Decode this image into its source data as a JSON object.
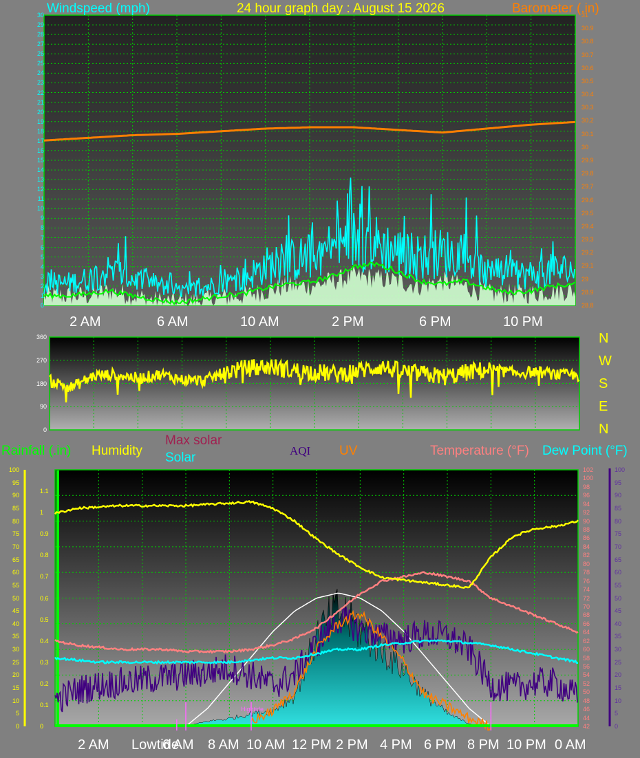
{
  "colors": {
    "background": "#808080",
    "grid": "#00d000",
    "windspeed": "#00ffff",
    "gust_under": "#d0ffd0",
    "wind_avg": "#00ff00",
    "barometer": "#ff7f00",
    "direction": "#ffff00",
    "humidity": "#ffff00",
    "temperature": "#ff8080",
    "dewpoint": "#00ffff",
    "solar": "#00cccc",
    "max_solar": "#ffffff",
    "aqi": "#400080",
    "uv": "#ff8000",
    "rainfall": "#00ff00",
    "markers": "#ff66ff"
  },
  "header": {
    "title": "24 hour graph day : August 15 2026",
    "windspeed_label": "Windspeed (mph)",
    "barometer_label": "Barometer (.in)"
  },
  "direction_panel": {
    "compass": [
      "N",
      "W",
      "S",
      "E",
      "N"
    ],
    "ticks": [
      "360",
      "270",
      "180",
      "90",
      "0"
    ]
  },
  "bottom_legend": {
    "rainfall": "Rainfall (.in)",
    "humidity": "Humidity",
    "max_solar": "Max solar",
    "solar": "Solar",
    "aqi": "AQI",
    "uv": "UV",
    "temperature": "Temperature (°F)",
    "dewpoint": "Dew Point (°F)",
    "lowtide": "Lowtide",
    "hightide": "Hightide"
  },
  "top_xlabels": [
    "2 AM",
    "6 AM",
    "10 AM",
    "2 PM",
    "6 PM",
    "10 PM"
  ],
  "bottom_xlabels": [
    "2 AM",
    "6 AM",
    "8 AM",
    "10 AM",
    "12 PM",
    "2 PM",
    "4 PM",
    "6 PM",
    "8 PM",
    "10 PM",
    "0 AM"
  ],
  "chart_data": [
    {
      "type": "line",
      "title": "24 hour graph day : August 15 2026",
      "x_unit": "hour",
      "xlim": [
        0,
        24
      ],
      "y_left": {
        "label": "Windspeed (mph)",
        "ylim": [
          0,
          30
        ],
        "ticks": [
          "0",
          "1",
          "2",
          "3",
          "4",
          "5",
          "6",
          "7",
          "8",
          "9",
          "10",
          "11",
          "12",
          "13",
          "14",
          "15",
          "16",
          "17",
          "18",
          "19",
          "20",
          "21",
          "22",
          "23",
          "24",
          "25",
          "26",
          "27",
          "28",
          "29",
          "30"
        ]
      },
      "y_right": {
        "label": "Barometer (.in)",
        "ylim": [
          28.8,
          31
        ],
        "ticks": [
          "28.8",
          "28.9",
          "29",
          "29.1",
          "29.2",
          "29.3",
          "29.4",
          "29.5",
          "29.6",
          "29.7",
          "29.8",
          "29.9",
          "30",
          "30.1",
          "30.2",
          "30.3",
          "30.4",
          "30.5",
          "30.6",
          "30.7",
          "30.8",
          "30.9",
          "31"
        ]
      },
      "series": [
        {
          "name": "Windspeed (mph)",
          "style": "spiky",
          "x": [
            0,
            1,
            2,
            3,
            4,
            5,
            6,
            7,
            8,
            9,
            10,
            11,
            12,
            13,
            14,
            15,
            16,
            17,
            18,
            19,
            20,
            21,
            22,
            23,
            24
          ],
          "values": [
            2.5,
            2.5,
            3,
            4,
            3,
            2.5,
            1.5,
            2,
            2.5,
            3,
            4.5,
            5,
            5.5,
            6.5,
            7.5,
            7,
            6,
            5.5,
            6,
            5.5,
            3.5,
            3.5,
            3.5,
            4,
            4
          ]
        },
        {
          "style": "filled",
          "x": [
            0,
            1,
            2,
            3,
            4,
            5,
            6,
            7,
            8,
            9,
            10,
            11,
            12,
            13,
            14,
            15,
            16,
            17,
            18,
            19,
            20,
            21,
            22,
            23,
            24
          ],
          "values": [
            1,
            1,
            1,
            1.5,
            1,
            0.5,
            0.3,
            0.5,
            0.8,
            1,
            1.5,
            2,
            2,
            2.5,
            3,
            2.8,
            2.5,
            2,
            2.5,
            2,
            1.2,
            1.2,
            1.2,
            1.5,
            1.5
          ]
        },
        {
          "style": "line",
          "x": [
            0,
            1,
            2,
            3,
            4,
            5,
            6,
            7,
            8,
            9,
            10,
            11,
            12,
            13,
            14,
            15,
            16,
            17,
            18,
            19,
            20,
            21,
            22,
            23,
            24
          ],
          "values": [
            1,
            1,
            1.2,
            1.5,
            1,
            0.6,
            0.3,
            0.6,
            1,
            1.2,
            1.8,
            2.2,
            2.4,
            3,
            4,
            4.3,
            3.5,
            2.5,
            2.2,
            2.5,
            1.8,
            1.3,
            1.5,
            2,
            2.2
          ]
        },
        {
          "name": "Barometer (.in)",
          "axis": "right",
          "x": [
            0,
            2,
            4,
            6,
            8,
            10,
            12,
            14,
            16,
            18,
            20,
            22,
            24
          ],
          "values": [
            30.05,
            30.07,
            30.09,
            30.1,
            30.12,
            30.14,
            30.15,
            30.15,
            30.13,
            30.11,
            30.14,
            30.17,
            30.19
          ]
        }
      ]
    },
    {
      "type": "line",
      "x_unit": "hour",
      "xlim": [
        0,
        24
      ],
      "ylim": [
        0,
        360
      ],
      "yticks": [
        "360",
        "270",
        "180",
        "90",
        "0"
      ],
      "series": [
        {
          "style": "spiky",
          "x": [
            0,
            1,
            2,
            3,
            4,
            5,
            6,
            7,
            8,
            9,
            10,
            11,
            12,
            13,
            14,
            15,
            16,
            17,
            18,
            19,
            20,
            21,
            22,
            23,
            24
          ],
          "values": [
            190,
            165,
            210,
            215,
            200,
            215,
            195,
            190,
            225,
            240,
            245,
            230,
            225,
            215,
            230,
            245,
            225,
            215,
            205,
            225,
            235,
            220,
            225,
            215,
            210
          ]
        }
      ]
    },
    {
      "type": "line",
      "x_unit": "hour",
      "xlim": [
        0,
        24
      ],
      "y_left": {
        "label": "Humidity / Solar",
        "ylim": [
          0,
          100
        ],
        "ticks": [
          "0",
          "5",
          "10",
          "15",
          "20",
          "25",
          "30",
          "35",
          "40",
          "45",
          "50",
          "55",
          "60",
          "65",
          "70",
          "75",
          "80",
          "85",
          "90",
          "95",
          "100"
        ]
      },
      "y_rain": {
        "label": "Rainfall (.in)",
        "ylim": [
          0,
          1.2
        ],
        "ticks": [
          "0",
          "0.1",
          "0.2",
          "0.3",
          "0.4",
          "0.5",
          "0.6",
          "0.7",
          "0.8",
          "0.9",
          "1",
          "1.1"
        ]
      },
      "y_temp": {
        "label": "Temperature (°F)",
        "ylim": [
          42,
          102
        ],
        "ticks": [
          "42",
          "44",
          "46",
          "48",
          "50",
          "52",
          "54",
          "56",
          "58",
          "60",
          "62",
          "64",
          "66",
          "68",
          "70",
          "72",
          "74",
          "76",
          "78",
          "80",
          "82",
          "84",
          "86",
          "88",
          "90",
          "92",
          "94",
          "96",
          "98",
          "100",
          "102"
        ]
      },
      "y_aqi": {
        "label": "AQI",
        "ylim": [
          0,
          100
        ],
        "ticks": [
          "0",
          "5",
          "10",
          "15",
          "20",
          "25",
          "30",
          "35",
          "40",
          "45",
          "50",
          "55",
          "60",
          "65",
          "70",
          "75",
          "80",
          "85",
          "90",
          "95",
          "100"
        ]
      },
      "series": [
        {
          "name": "Humidity",
          "axis": "left",
          "x": [
            0,
            1,
            2,
            3,
            4,
            5,
            6,
            7,
            8,
            9,
            10,
            11,
            12,
            13,
            14,
            15,
            16,
            17,
            18,
            19,
            20,
            21,
            22,
            23,
            24
          ],
          "values": [
            83,
            85,
            85.5,
            86,
            86,
            86,
            86,
            86.5,
            87,
            87.5,
            85,
            80,
            73,
            67,
            62,
            58,
            57,
            56,
            55,
            54,
            66,
            74,
            77,
            78,
            80
          ]
        },
        {
          "name": "Temperature (°F)",
          "axis": "temp",
          "x": [
            0,
            1,
            2,
            3,
            4,
            5,
            6,
            7,
            8,
            9,
            10,
            11,
            12,
            13,
            14,
            15,
            16,
            17,
            18,
            19,
            20,
            21,
            22,
            23,
            24
          ],
          "values": [
            62,
            61,
            60.5,
            60,
            60,
            60,
            59.5,
            59.5,
            59.5,
            60,
            61,
            62.5,
            65,
            69,
            73,
            76,
            77,
            78,
            77,
            76,
            72,
            70,
            68,
            66,
            64
          ]
        },
        {
          "name": "Dew Point (°F)",
          "axis": "temp",
          "x": [
            0,
            1,
            2,
            3,
            4,
            5,
            6,
            7,
            8,
            9,
            10,
            11,
            12,
            13,
            14,
            15,
            16,
            17,
            18,
            19,
            20,
            21,
            22,
            23,
            24
          ],
          "values": [
            58,
            57.5,
            57,
            57,
            57,
            57,
            57,
            57,
            57,
            57.5,
            58,
            58,
            59,
            60,
            60,
            61,
            61.5,
            62,
            62,
            61.5,
            61,
            60,
            59,
            58,
            57
          ]
        },
        {
          "name": "Max solar",
          "axis": "left",
          "x": [
            6,
            7,
            8,
            9,
            10,
            11,
            12,
            13,
            14,
            15,
            16,
            17,
            18,
            19,
            20
          ],
          "values": [
            0,
            7,
            17,
            27,
            37,
            45,
            50,
            52,
            50,
            45,
            37,
            27,
            17,
            7,
            0
          ]
        },
        {
          "name": "Solar",
          "axis": "left",
          "style": "filled",
          "x": [
            6,
            7,
            8,
            9,
            10,
            11,
            12,
            13,
            14,
            15,
            16,
            17,
            18,
            19,
            20
          ],
          "values": [
            0,
            2,
            3,
            5,
            6,
            12,
            35,
            45,
            38,
            30,
            22,
            12,
            5,
            1,
            0
          ]
        },
        {
          "name": "UV",
          "axis": "left",
          "x": [
            9,
            10,
            11,
            12,
            13,
            14,
            15,
            16,
            17,
            18,
            19,
            20
          ],
          "values": [
            2,
            6,
            14,
            30,
            40,
            44,
            35,
            25,
            12,
            8,
            3,
            0
          ]
        },
        {
          "name": "AQI",
          "axis": "aqi",
          "style": "noisy",
          "x": [
            0,
            1,
            2,
            3,
            4,
            5,
            6,
            7,
            8,
            9,
            10,
            11,
            12,
            13,
            14,
            15,
            16,
            17,
            18,
            19,
            20,
            21,
            22,
            23,
            24
          ],
          "values": [
            10,
            14,
            16,
            17,
            18,
            19,
            20,
            21,
            23,
            20,
            16,
            20,
            32,
            42,
            38,
            35,
            34,
            36,
            35,
            30,
            16,
            15,
            17,
            17,
            11
          ]
        },
        {
          "name": "Rainfall (.in)",
          "axis": "rain",
          "x": [
            0,
            24
          ],
          "values": [
            0,
            0
          ]
        }
      ]
    }
  ]
}
